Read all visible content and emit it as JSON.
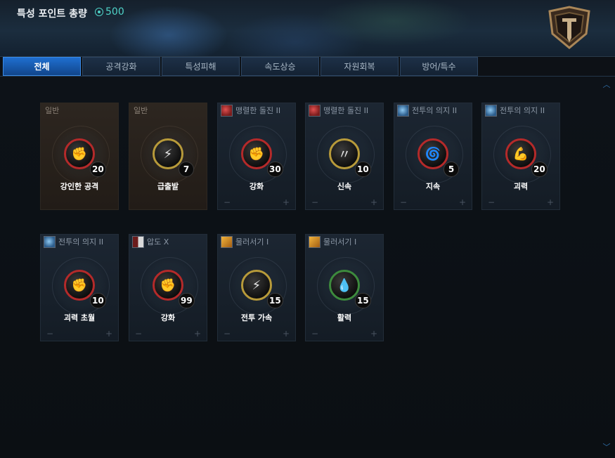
{
  "header": {
    "title": "특성 포인트 총량",
    "points": "500"
  },
  "tabs": [
    {
      "label": "전체",
      "active": true
    },
    {
      "label": "공격강화",
      "active": false
    },
    {
      "label": "특성피해",
      "active": false
    },
    {
      "label": "속도상승",
      "active": false
    },
    {
      "label": "자원회복",
      "active": false
    },
    {
      "label": "방어/특수",
      "active": false
    }
  ],
  "cards": [
    {
      "source": "일반",
      "skill": "강인한 공격",
      "level": "20",
      "icon": "fist-icon",
      "ring_color": "#b42a2a"
    },
    {
      "source": "일반",
      "skill": "급출발",
      "level": "7",
      "icon": "boot-icon",
      "ring_color": "#b79a3a"
    },
    {
      "source": "맹렬한 돌진 II",
      "skill": "강화",
      "level": "30",
      "icon": "fist-icon",
      "ring_color": "#b42a2a"
    },
    {
      "source": "맹렬한 돌진 II",
      "skill": "신속",
      "level": "10",
      "icon": "slash-icon",
      "ring_color": "#b79a3a"
    },
    {
      "source": "전투의 의지 II",
      "skill": "지속",
      "level": "5",
      "icon": "swirl-icon",
      "ring_color": "#b42a2a"
    },
    {
      "source": "전투의 의지 II",
      "skill": "괴력",
      "level": "20",
      "icon": "arm-icon",
      "ring_color": "#b42a2a"
    },
    {
      "source": "전투의 의지 II",
      "skill": "괴력 초월",
      "level": "10",
      "icon": "fist-icon",
      "ring_color": "#b42a2a"
    },
    {
      "source": "압도 X",
      "skill": "강화",
      "level": "99",
      "icon": "fist-icon",
      "ring_color": "#b42a2a"
    },
    {
      "source": "물러서기 I",
      "skill": "전투 가속",
      "level": "15",
      "icon": "boot-icon",
      "ring_color": "#b79a3a"
    },
    {
      "source": "물러서기 I",
      "skill": "활력",
      "level": "15",
      "icon": "drops-icon",
      "ring_color": "#3d8a3d"
    }
  ],
  "controls": {
    "minus": "−",
    "plus": "+"
  }
}
